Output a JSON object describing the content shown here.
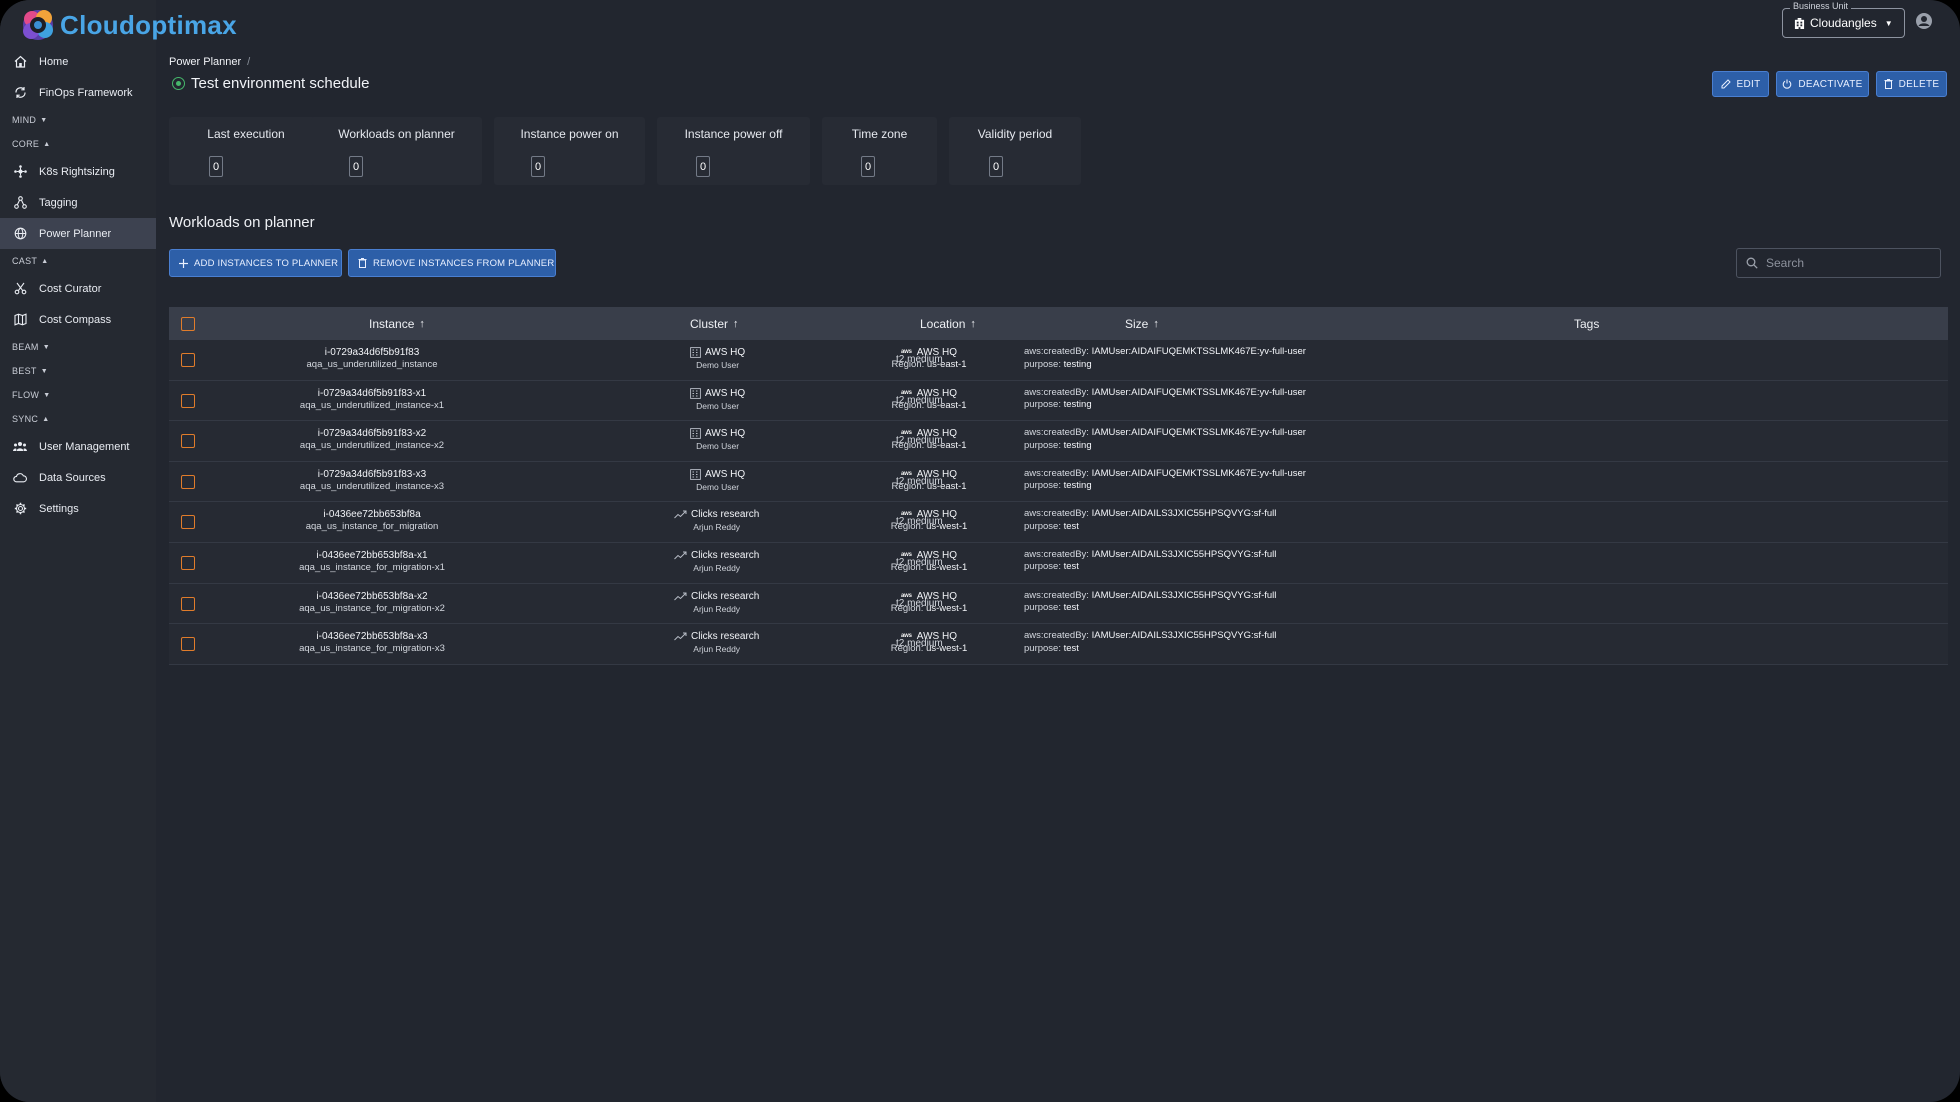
{
  "app": {
    "name": "Cloudoptimax",
    "brand_color": "#49a5e6"
  },
  "sidebar": {
    "items": [
      {
        "type": "item",
        "label": "Home",
        "icon": "home-icon",
        "name": "sidebar-item-home"
      },
      {
        "type": "item",
        "label": "FinOps Framework",
        "icon": "cycle-icon",
        "name": "sidebar-item-finops-framework"
      },
      {
        "type": "section",
        "label": "MIND",
        "caret": "▼",
        "name": "sidebar-section-mind"
      },
      {
        "type": "section",
        "label": "CORE",
        "caret": "▲",
        "name": "sidebar-section-core"
      },
      {
        "type": "item",
        "label": "K8s Rightsizing",
        "icon": "hub-icon",
        "name": "sidebar-item-k8s-rightsizing"
      },
      {
        "type": "item",
        "label": "Tagging",
        "icon": "tag-tree-icon",
        "name": "sidebar-item-tagging"
      },
      {
        "type": "item",
        "label": "Power Planner",
        "icon": "globe-icon",
        "name": "sidebar-item-power-planner",
        "active": true
      },
      {
        "type": "section",
        "label": "CAST",
        "caret": "▲",
        "name": "sidebar-section-cast"
      },
      {
        "type": "item",
        "label": "Cost Curator",
        "icon": "scissors-icon",
        "name": "sidebar-item-cost-curator"
      },
      {
        "type": "item",
        "label": "Cost Compass",
        "icon": "map-icon",
        "name": "sidebar-item-cost-compass"
      },
      {
        "type": "section",
        "label": "BEAM",
        "caret": "▼",
        "name": "sidebar-section-beam"
      },
      {
        "type": "section",
        "label": "BEST",
        "caret": "▼",
        "name": "sidebar-section-best"
      },
      {
        "type": "section",
        "label": "FLOW",
        "caret": "▼",
        "name": "sidebar-section-flow"
      },
      {
        "type": "section",
        "label": "SYNC",
        "caret": "▲",
        "name": "sidebar-section-sync"
      },
      {
        "type": "item",
        "label": "User Management",
        "icon": "users-icon",
        "name": "sidebar-item-user-management"
      },
      {
        "type": "item",
        "label": "Data Sources",
        "icon": "cloud-icon",
        "name": "sidebar-item-data-sources"
      },
      {
        "type": "item",
        "label": "Settings",
        "icon": "gear-icon",
        "name": "sidebar-item-settings"
      }
    ]
  },
  "topbar": {
    "business_unit_label": "Business Unit",
    "business_unit_value": "Cloudangles",
    "user_icon": "account-circle-icon"
  },
  "header": {
    "breadcrumb": "Power Planner",
    "breadcrumb_sep": "/",
    "title": "Test environment schedule",
    "status_color": "#46b86b",
    "actions": {
      "edit": "EDIT",
      "deactivate": "DEACTIVATE",
      "delete": "DELETE"
    }
  },
  "summary": [
    {
      "label": "Last execution",
      "value": "0"
    },
    {
      "label": "Workloads on planner",
      "value": "0"
    },
    {
      "label": "Instance power on",
      "value": "0"
    },
    {
      "label": "Instance power off",
      "value": "0"
    },
    {
      "label": "Time zone",
      "value": "0"
    },
    {
      "label": "Validity period",
      "value": "0"
    }
  ],
  "workloads": {
    "title": "Workloads on planner",
    "add_label": "ADD INSTANCES TO PLANNER",
    "remove_label": "REMOVE INSTANCES FROM PLANNER",
    "search_placeholder": "Search",
    "accent_color": "#e07c2b",
    "columns": {
      "instance": "Instance",
      "cluster": "Cluster",
      "location": "Location",
      "size": "Size",
      "tags": "Tags",
      "sort_arrow": "↑"
    },
    "rows": [
      {
        "id": "i-0729a34d6f5b91f83",
        "name": "aqa_us_underutilized_instance",
        "cluster": "AWS HQ",
        "cluster_user": "Demo User",
        "cluster_icon": "building-icon",
        "location": "AWS HQ",
        "region_label": "Region:",
        "region": "us-east-1",
        "size": "t2.medium",
        "tag1_key": "aws:createdBy:",
        "tag1_val": "IAMUser:AIDAIFUQEMKTSSLMK467E:yv-full-user",
        "tag2_key": "purpose:",
        "tag2_val": "testing"
      },
      {
        "id": "i-0729a34d6f5b91f83-x1",
        "name": "aqa_us_underutilized_instance-x1",
        "cluster": "AWS HQ",
        "cluster_user": "Demo User",
        "cluster_icon": "building-icon",
        "location": "AWS HQ",
        "region_label": "Region:",
        "region": "us-east-1",
        "size": "t2.medium",
        "tag1_key": "aws:createdBy:",
        "tag1_val": "IAMUser:AIDAIFUQEMKTSSLMK467E:yv-full-user",
        "tag2_key": "purpose:",
        "tag2_val": "testing"
      },
      {
        "id": "i-0729a34d6f5b91f83-x2",
        "name": "aqa_us_underutilized_instance-x2",
        "cluster": "AWS HQ",
        "cluster_user": "Demo User",
        "cluster_icon": "building-icon",
        "location": "AWS HQ",
        "region_label": "Region:",
        "region": "us-east-1",
        "size": "t2.medium",
        "tag1_key": "aws:createdBy:",
        "tag1_val": "IAMUser:AIDAIFUQEMKTSSLMK467E:yv-full-user",
        "tag2_key": "purpose:",
        "tag2_val": "testing"
      },
      {
        "id": "i-0729a34d6f5b91f83-x3",
        "name": "aqa_us_underutilized_instance-x3",
        "cluster": "AWS HQ",
        "cluster_user": "Demo User",
        "cluster_icon": "building-icon",
        "location": "AWS HQ",
        "region_label": "Region:",
        "region": "us-east-1",
        "size": "t2.medium",
        "tag1_key": "aws:createdBy:",
        "tag1_val": "IAMUser:AIDAIFUQEMKTSSLMK467E:yv-full-user",
        "tag2_key": "purpose:",
        "tag2_val": "testing"
      },
      {
        "id": "i-0436ee72bb653bf8a",
        "name": "aqa_us_instance_for_migration",
        "cluster": "Clicks research",
        "cluster_user": "Arjun Reddy",
        "cluster_icon": "trend-icon",
        "location": "AWS HQ",
        "region_label": "Region:",
        "region": "us-west-1",
        "size": "t2.medium",
        "tag1_key": "aws:createdBy:",
        "tag1_val": "IAMUser:AIDAILS3JXIC55HPSQVYG:sf-full",
        "tag2_key": "purpose:",
        "tag2_val": "test"
      },
      {
        "id": "i-0436ee72bb653bf8a-x1",
        "name": "aqa_us_instance_for_migration-x1",
        "cluster": "Clicks research",
        "cluster_user": "Arjun Reddy",
        "cluster_icon": "trend-icon",
        "location": "AWS HQ",
        "region_label": "Region:",
        "region": "us-west-1",
        "size": "t2.medium",
        "tag1_key": "aws:createdBy:",
        "tag1_val": "IAMUser:AIDAILS3JXIC55HPSQVYG:sf-full",
        "tag2_key": "purpose:",
        "tag2_val": "test"
      },
      {
        "id": "i-0436ee72bb653bf8a-x2",
        "name": "aqa_us_instance_for_migration-x2",
        "cluster": "Clicks research",
        "cluster_user": "Arjun Reddy",
        "cluster_icon": "trend-icon",
        "location": "AWS HQ",
        "region_label": "Region:",
        "region": "us-west-1",
        "size": "t2.medium",
        "tag1_key": "aws:createdBy:",
        "tag1_val": "IAMUser:AIDAILS3JXIC55HPSQVYG:sf-full",
        "tag2_key": "purpose:",
        "tag2_val": "test"
      },
      {
        "id": "i-0436ee72bb653bf8a-x3",
        "name": "aqa_us_instance_for_migration-x3",
        "cluster": "Clicks research",
        "cluster_user": "Arjun Reddy",
        "cluster_icon": "trend-icon",
        "location": "AWS HQ",
        "region_label": "Region:",
        "region": "us-west-1",
        "size": "t2.medium",
        "tag1_key": "aws:createdBy:",
        "tag1_val": "IAMUser:AIDAILS3JXIC55HPSQVYG:sf-full",
        "tag2_key": "purpose:",
        "tag2_val": "test"
      }
    ]
  }
}
